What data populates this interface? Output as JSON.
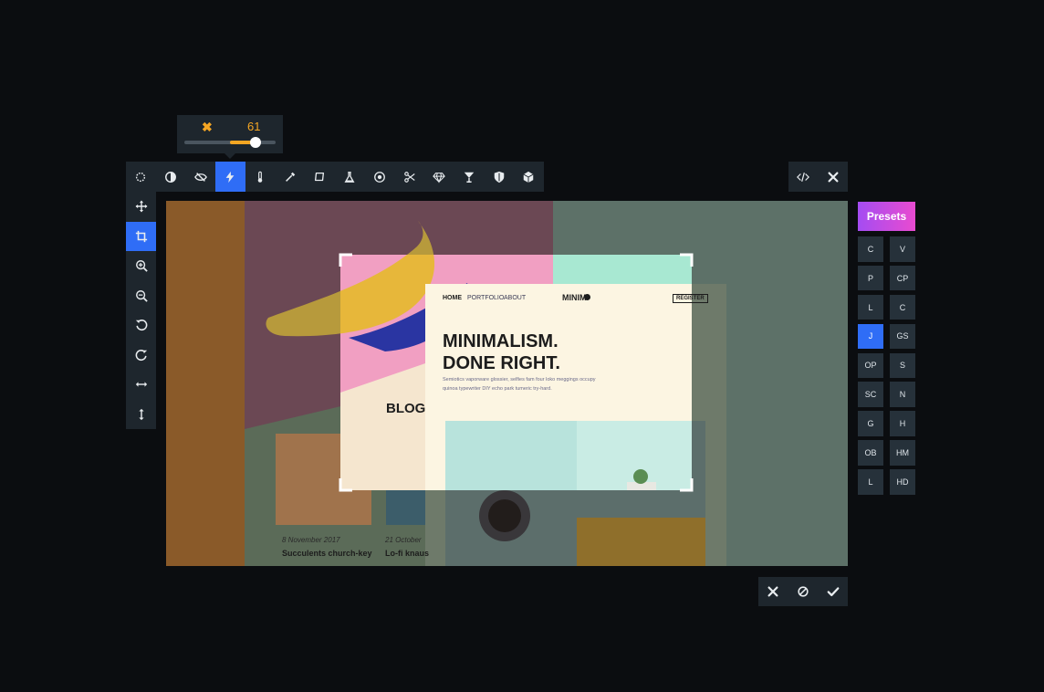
{
  "slider": {
    "icon": "close-icon",
    "value": "61",
    "fill_fraction": 0.78
  },
  "top_toolbar": {
    "tools": [
      {
        "name": "filter-icon"
      },
      {
        "name": "contrast-icon"
      },
      {
        "name": "hide-icon"
      },
      {
        "name": "flash-icon",
        "active": true
      },
      {
        "name": "temperature-icon"
      },
      {
        "name": "eyedropper-icon"
      },
      {
        "name": "shape-icon"
      },
      {
        "name": "flask-icon"
      },
      {
        "name": "target-icon"
      },
      {
        "name": "scissors-icon"
      },
      {
        "name": "diamond-icon"
      },
      {
        "name": "glass-icon"
      },
      {
        "name": "shield-icon"
      },
      {
        "name": "cube-icon"
      }
    ]
  },
  "code_group": {
    "tools": [
      {
        "name": "code-icon"
      },
      {
        "name": "close-icon"
      }
    ]
  },
  "left_toolbar": {
    "tools": [
      {
        "name": "move-icon"
      },
      {
        "name": "crop-icon",
        "active": true
      },
      {
        "name": "zoom-in-icon"
      },
      {
        "name": "zoom-out-icon"
      },
      {
        "name": "rotate-left-icon"
      },
      {
        "name": "rotate-right-icon"
      },
      {
        "name": "flip-horizontal-icon"
      },
      {
        "name": "flip-vertical-icon"
      }
    ]
  },
  "bottom_actions": {
    "tools": [
      {
        "name": "close-icon"
      },
      {
        "name": "cancel-icon"
      },
      {
        "name": "check-icon"
      }
    ]
  },
  "presets": {
    "label": "Presets",
    "items": [
      "C",
      "V",
      "P",
      "CP",
      "L",
      "C",
      "J",
      "GS",
      "OP",
      "S",
      "SC",
      "N",
      "G",
      "H",
      "OB",
      "HM",
      "L",
      "HD"
    ],
    "active_index": 6
  },
  "mockup": {
    "nav": [
      "HOME",
      "PORTFOLIO",
      "ABOUT"
    ],
    "logo": "MINIM",
    "register": "REGISTER",
    "headline_1": "MINIMALISM.",
    "headline_2": "DONE RIGHT.",
    "body_1": "Semiotics vaporware glossier, selfies fam four loko meggings occupy",
    "body_2": "quinoa typewriter DIY echo park tumeric try-hard.",
    "blog_title": "BLOG",
    "post_1_date": "8 November 2017",
    "post_1_title": "Succulents church-key",
    "post_2_date": "21 October",
    "post_2_title": "Lo-fi knaus"
  },
  "colors": {
    "accent": "#2f6df6",
    "slider": "#f5a623",
    "panel": "#1e262d",
    "background": "#0b0d10"
  }
}
